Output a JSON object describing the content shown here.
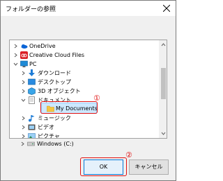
{
  "window": {
    "title": "フォルダーの参照"
  },
  "tree": {
    "items": [
      {
        "label": "OneDrive",
        "icon": "onedrive-icon",
        "expander": "collapsed"
      },
      {
        "label": "Creative Cloud Files",
        "icon": "creative-cloud-icon",
        "expander": "collapsed"
      },
      {
        "label": "PC",
        "icon": "pc-icon",
        "expander": "expanded"
      },
      {
        "label": "ダウンロード",
        "icon": "download-icon",
        "expander": "collapsed"
      },
      {
        "label": "デスクトップ",
        "icon": "desktop-icon",
        "expander": "collapsed"
      },
      {
        "label": "3D オブジェクト",
        "icon": "3d-objects-icon",
        "expander": "collapsed"
      },
      {
        "label": "ドキュメント",
        "icon": "documents-icon",
        "expander": "expanded"
      },
      {
        "label": "My Documents",
        "icon": "folder-icon",
        "expander": "none",
        "selected": true
      },
      {
        "label": "ミュージック",
        "icon": "music-icon",
        "expander": "collapsed"
      },
      {
        "label": "ビデオ",
        "icon": "video-icon",
        "expander": "collapsed"
      },
      {
        "label": "ピクチャ",
        "icon": "pictures-icon",
        "expander": "collapsed"
      },
      {
        "label": "Windows (C:)",
        "icon": "drive-icon",
        "expander": "collapsed"
      }
    ]
  },
  "buttons": {
    "ok": "OK",
    "cancel": "キャンセル"
  },
  "annotations": {
    "first": "①",
    "second": "②"
  },
  "colors": {
    "annotation": "#e01010",
    "selection": "#cce8ff",
    "focus": "#0078d7"
  }
}
